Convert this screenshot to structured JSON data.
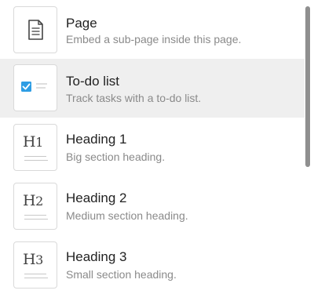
{
  "menu": {
    "items": [
      {
        "title": "Page",
        "description": "Embed a sub-page inside this page.",
        "icon": "page-icon"
      },
      {
        "title": "To-do list",
        "description": "Track tasks with a to-do list.",
        "icon": "todo-checkbox-icon"
      },
      {
        "title": "Heading 1",
        "description": "Big section heading.",
        "icon": "heading-1-icon",
        "icon_text": "H1"
      },
      {
        "title": "Heading 2",
        "description": "Medium section heading.",
        "icon": "heading-2-icon",
        "icon_text": "H2"
      },
      {
        "title": "Heading 3",
        "description": "Small section heading.",
        "icon": "heading-3-icon",
        "icon_text": "H3"
      }
    ],
    "selected_index": 1
  },
  "colors": {
    "selected_background": "#efefef",
    "checkbox_blue": "#2e9de4",
    "scrollbar": "#8f8f8f"
  }
}
